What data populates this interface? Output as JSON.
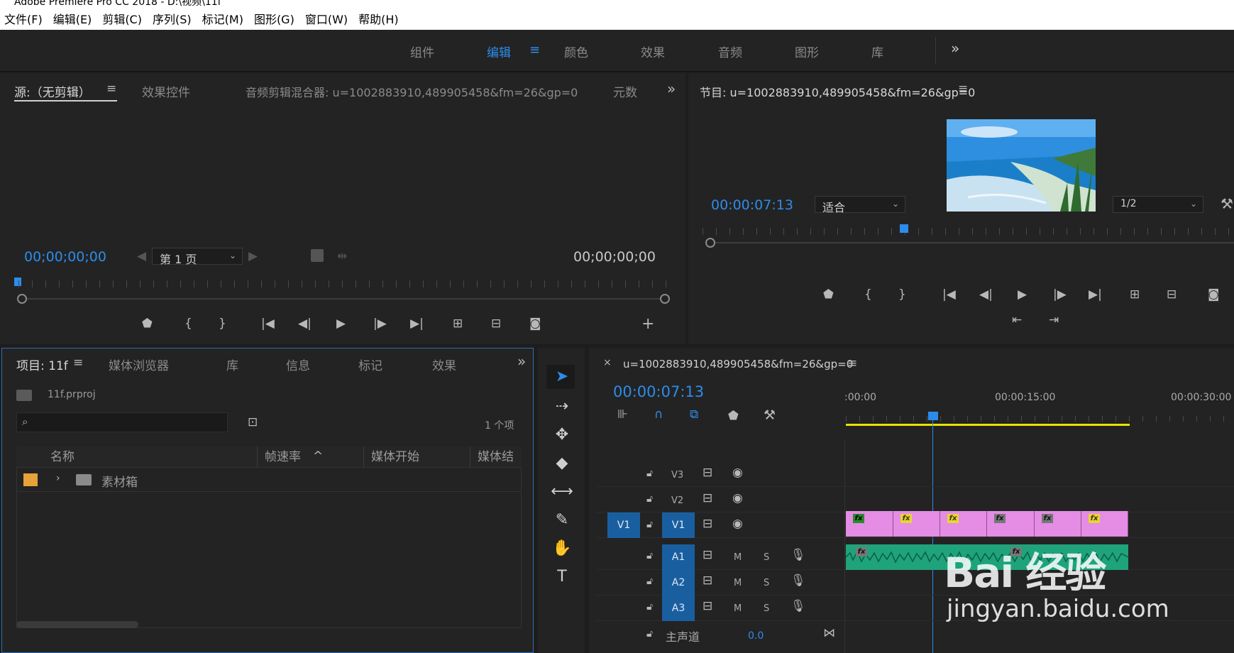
{
  "window_title": "Adobe Premiere Pro CC 2018 - D:\\视频\\11f",
  "menu": [
    "文件(F)",
    "编辑(E)",
    "剪辑(C)",
    "序列(S)",
    "标记(M)",
    "图形(G)",
    "窗口(W)",
    "帮助(H)"
  ],
  "workspaces": [
    "组件",
    "编辑",
    "颜色",
    "效果",
    "音频",
    "图形",
    "库"
  ],
  "workspace_menu_glyph": "≡",
  "overflow_glyph": "»",
  "source_panel": {
    "tabs": [
      "源:（无剪辑）",
      "效果控件",
      "音频剪辑混合器: u=1002883910,489905458&fm=26&gp=0",
      "元数"
    ],
    "timecode_in": "00;00;00;00",
    "timecode_out": "00;00;00;00",
    "page_select": "第 1 页"
  },
  "program_panel": {
    "title": "节目: u=1002883910,489905458&fm=26&gp=0",
    "timecode": "00:00:07:13",
    "fit_select": "适合",
    "resolution_select": "1/2"
  },
  "project_panel": {
    "tabs": [
      "项目: 11f",
      "媒体浏览器",
      "库",
      "信息",
      "标记",
      "效果"
    ],
    "file_name": "11f.prproj",
    "item_count": "1 个项",
    "search_placeholder": "",
    "columns": [
      "名称",
      "帧速率",
      "媒体开始",
      "媒体结"
    ],
    "rows": [
      {
        "name": "素材箱",
        "color": "#e8a23a"
      }
    ]
  },
  "timeline_panel": {
    "close_glyph": "×",
    "sequence_name": "u=1002883910,489905458&fm=26&gp=0",
    "timecode": "00:00:07:13",
    "ruler_labels": [
      ":00:00",
      "00:00:15:00",
      "00:00:30:00"
    ],
    "tracks": {
      "v3": "V3",
      "v2": "V2",
      "v1_source": "V1",
      "v1": "V1",
      "a1": "A1",
      "a2": "A2",
      "a3": "A3",
      "mute": "M",
      "solo": "S",
      "master_label": "主声道",
      "master_value": "0.0"
    }
  },
  "watermark": {
    "logo_text": "Bai 经验",
    "url_text": "jingyan.baidu.com"
  },
  "colors": {
    "accent": "#2d8ceb",
    "video_clip": "#e58ce4",
    "audio_clip": "#1fa37a",
    "work_area": "#e5e500"
  }
}
